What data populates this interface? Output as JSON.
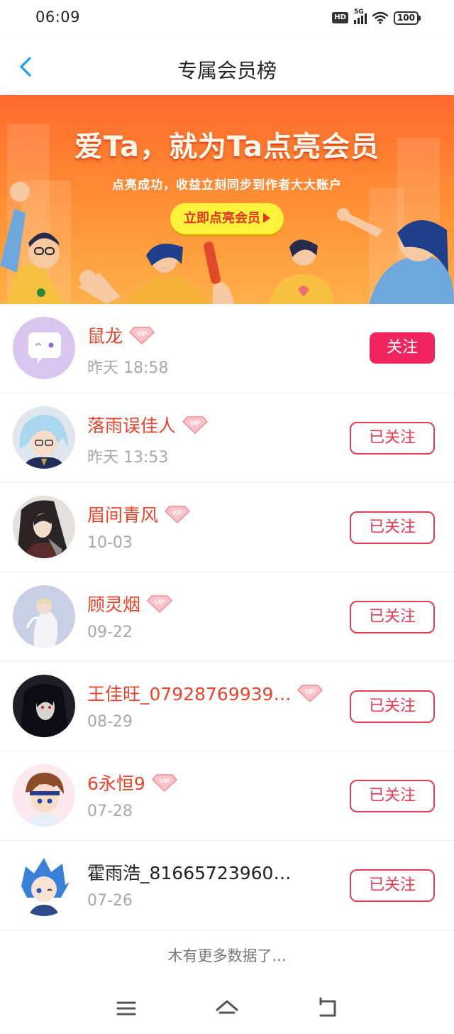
{
  "status_bar": {
    "time": "06:09",
    "hd": "HD",
    "network": "5G",
    "battery": "100",
    "icons": [
      "hd-icon",
      "signal-icon",
      "wifi-icon",
      "battery-icon"
    ]
  },
  "header": {
    "title": "专属会员榜",
    "back_icon": "chevron-left-icon"
  },
  "banner": {
    "headline": "爱Ta，就为Ta点亮会员",
    "subtitle": "点亮成功，收益立刻同步到作者大大账户",
    "cta_label": "立即点亮会员"
  },
  "members": [
    {
      "name": "鼠龙",
      "vip": true,
      "time": "昨天 18:58",
      "button": "关注",
      "followed": false
    },
    {
      "name": "落雨误佳人",
      "vip": true,
      "time": "昨天 13:53",
      "button": "已关注",
      "followed": true
    },
    {
      "name": "眉间青风",
      "vip": true,
      "time": "10-03",
      "button": "已关注",
      "followed": true
    },
    {
      "name": "顾灵烟",
      "vip": true,
      "time": "09-22",
      "button": "已关注",
      "followed": true
    },
    {
      "name": "王佳旺_07928769939…",
      "vip": true,
      "time": "08-29",
      "button": "已关注",
      "followed": true
    },
    {
      "name": "6永恒9",
      "vip": true,
      "time": "07-28",
      "button": "已关注",
      "followed": true
    },
    {
      "name": "霍雨浩_81665723960…",
      "vip": false,
      "time": "07-26",
      "button": "已关注",
      "followed": true
    }
  ],
  "vip_label": "VIP",
  "footer_note": "木有更多数据了...",
  "nav": {
    "icons": [
      "menu-icon",
      "home-icon",
      "back-icon"
    ]
  },
  "colors": {
    "accent": "#f0245f",
    "vip_name": "#e8442c",
    "banner_orange": "#ff7a30",
    "cta_yellow": "#fff23a"
  }
}
